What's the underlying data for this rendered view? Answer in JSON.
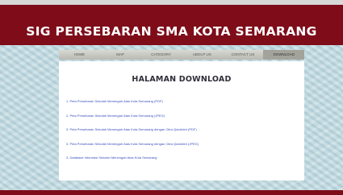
{
  "site": {
    "title": "SIG PERSEBARAN SMA KOTA SEMARANG"
  },
  "nav": {
    "items": [
      {
        "label": "HOME"
      },
      {
        "label": "MAP"
      },
      {
        "label": "CATEGORY"
      },
      {
        "label": "ABOUT US"
      },
      {
        "label": "CONTACT US"
      },
      {
        "label": "DOWNLOAD"
      }
    ],
    "active": "DOWNLOAD"
  },
  "page": {
    "heading": "HALAMAN DOWNLOAD",
    "downloads": [
      {
        "number": "1.",
        "label": "Peta Persebaran Sekolah Menengah Atas Kota Semarang (PDF)"
      },
      {
        "number": "2.",
        "label": "Peta Persebaran Sekolah Menengah Atas Kota Semarang (JPEG)"
      },
      {
        "number": "3.",
        "label": "Peta Persebaran Sekolah Menengah Atas Kota Semarang dengan Citra Quickbird (PDF)"
      },
      {
        "number": "3.",
        "label": "Peta Persebaran Sekolah Menengah Atas Kota Semarang dengan Citra Quickbird (JPEG)"
      },
      {
        "number": "3.",
        "label": "Database Informasi Sekolah Menengah Atas Kota Semarang"
      }
    ]
  },
  "colors": {
    "header": "#7e0c19",
    "background": "#c3dbe1",
    "link": "#3a4fbf",
    "nav_active": "#a3a39b"
  }
}
